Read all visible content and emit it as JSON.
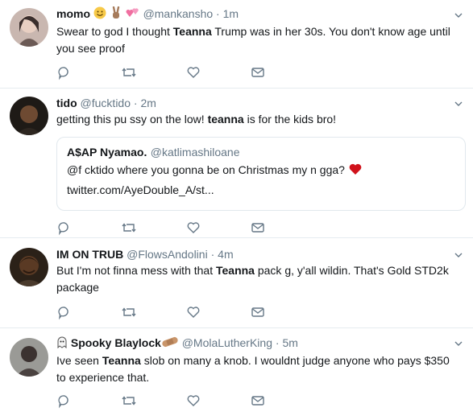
{
  "tweets": [
    {
      "name": "momo",
      "name_emojis": [
        "smiley",
        "victory-hand",
        "pink-hearts"
      ],
      "handle": "@mankansho",
      "time": "1m",
      "text_parts": [
        "Swear to god I thought ",
        "Teanna",
        " Trump was in her 30s. You don't know age until you see proof"
      ]
    },
    {
      "name": "tido",
      "handle": "@fucktido",
      "time": "2m",
      "text_parts": [
        "getting this pu  ssy on the low! ",
        "teanna",
        " is for the kids bro!"
      ],
      "quote": {
        "name": "A$AP Nyamao.",
        "handle": "@katlimashiloane",
        "text": "@f  cktido where you gonna be on Christmas my n  gga?",
        "link": "twitter.com/AyeDouble_A/st..."
      }
    },
    {
      "name": "IM ON TRUB",
      "handle": "@FlowsAndolini",
      "time": "4m",
      "text_parts": [
        "But I'm not finna mess with that ",
        "Teanna",
        " pack g, y'all wildin. That's Gold STD2k package"
      ]
    },
    {
      "name": "Spooky Blaylock",
      "name_emojis": [
        "ghost",
        "bandage"
      ],
      "handle": "@MolaLutherKing",
      "time": "5m",
      "text_parts": [
        "Ive seen ",
        "Teanna",
        " slob on many a knob. I wouldnt judge anyone who pays $350 to experience that."
      ]
    }
  ],
  "separator": "·",
  "action_icons": [
    "reply-icon",
    "retweet-icon",
    "like-icon",
    "direct-message-icon"
  ],
  "colors": {
    "text": "#14171a",
    "muted": "#657786",
    "border": "#e6ecf0",
    "heart": "#e0245e",
    "action": "#657786"
  }
}
